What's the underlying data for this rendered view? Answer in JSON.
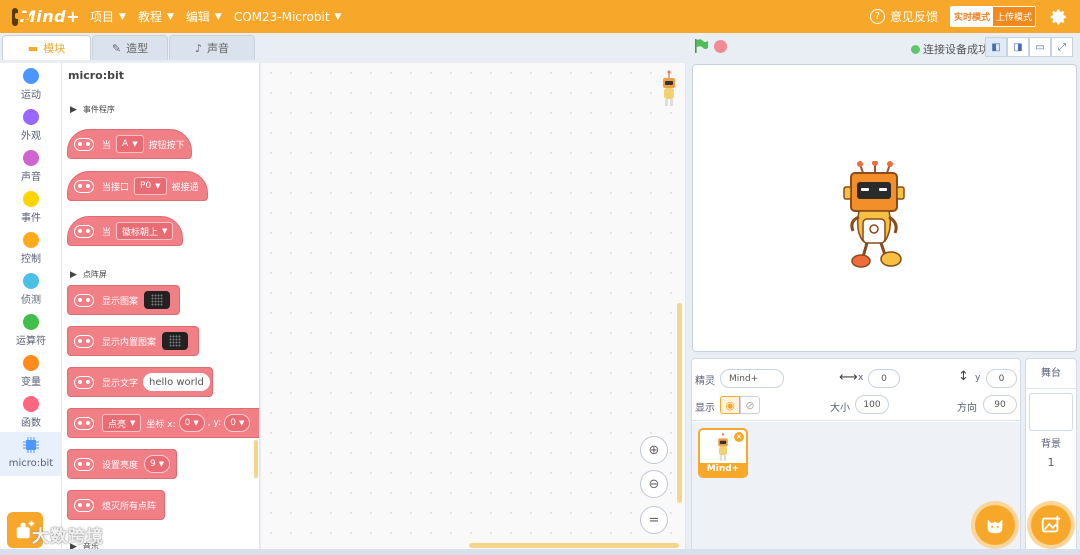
{
  "app": {
    "logo": "Mind+"
  },
  "menu": [
    {
      "label": "项目"
    },
    {
      "label": "教程"
    },
    {
      "label": "编辑"
    },
    {
      "label": "COM23-Microbit"
    }
  ],
  "topright": {
    "feedback": "意见反馈",
    "mode_live": "实时模式",
    "mode_upload": "上传模式"
  },
  "tabs": {
    "blocks": "模块",
    "costumes": "造型",
    "sounds": "声音"
  },
  "connection": {
    "status": "连接设备成功",
    "color": "#5ec76b"
  },
  "categories": [
    {
      "label": "运动",
      "color": "#4c97ff"
    },
    {
      "label": "外观",
      "color": "#9966ff"
    },
    {
      "label": "声音",
      "color": "#cf63cf"
    },
    {
      "label": "事件",
      "color": "#ffd500"
    },
    {
      "label": "控制",
      "color": "#ffab19"
    },
    {
      "label": "侦测",
      "color": "#4cbfe6"
    },
    {
      "label": "运算符",
      "color": "#40bf4a"
    },
    {
      "label": "变量",
      "color": "#ff8c1a"
    },
    {
      "label": "函数",
      "color": "#ff6680"
    },
    {
      "label": "micro:bit",
      "color": "#4c97ff"
    }
  ],
  "palette": {
    "title": "micro:bit",
    "section_events": "事件程序",
    "section_matrix": "点阵屏",
    "section_more": "音乐",
    "blocks": {
      "b1_when": "当",
      "b1_dd": "A",
      "b1_tail": "按钮按下",
      "b2_when": "当接口",
      "b2_dd": "P0",
      "b2_tail": "被接通",
      "b3_when": "当",
      "b3_dd": "徽标朝上",
      "b4_text": "显示图案",
      "b5_text": "显示内置图案",
      "b6_text": "显示文字",
      "b6_value": "hello world",
      "b7_dd": "点亮",
      "b7_x": "坐标 x:",
      "b7_xval": "0",
      "b7_y": ", y:",
      "b7_yval": "0",
      "b8_text": "设置亮度",
      "b8_val": "9",
      "b9_text": "熄灭所有点阵"
    },
    "block_color": "#f07f86"
  },
  "sprite_info": {
    "sprite_label": "精灵",
    "sprite_name": "Mind+",
    "x_label": "x",
    "x_value": "0",
    "y_label": "y",
    "y_value": "0",
    "show_label": "显示",
    "size_label": "大小",
    "size_value": "100",
    "direction_label": "方向",
    "direction_value": "90"
  },
  "sprites": [
    {
      "name": "Mind+"
    }
  ],
  "stage_panel": {
    "title": "舞台",
    "backdrops_label": "背景",
    "backdrops_count": "1"
  },
  "watermark": "大数跨境",
  "accent": "#f7a82b"
}
